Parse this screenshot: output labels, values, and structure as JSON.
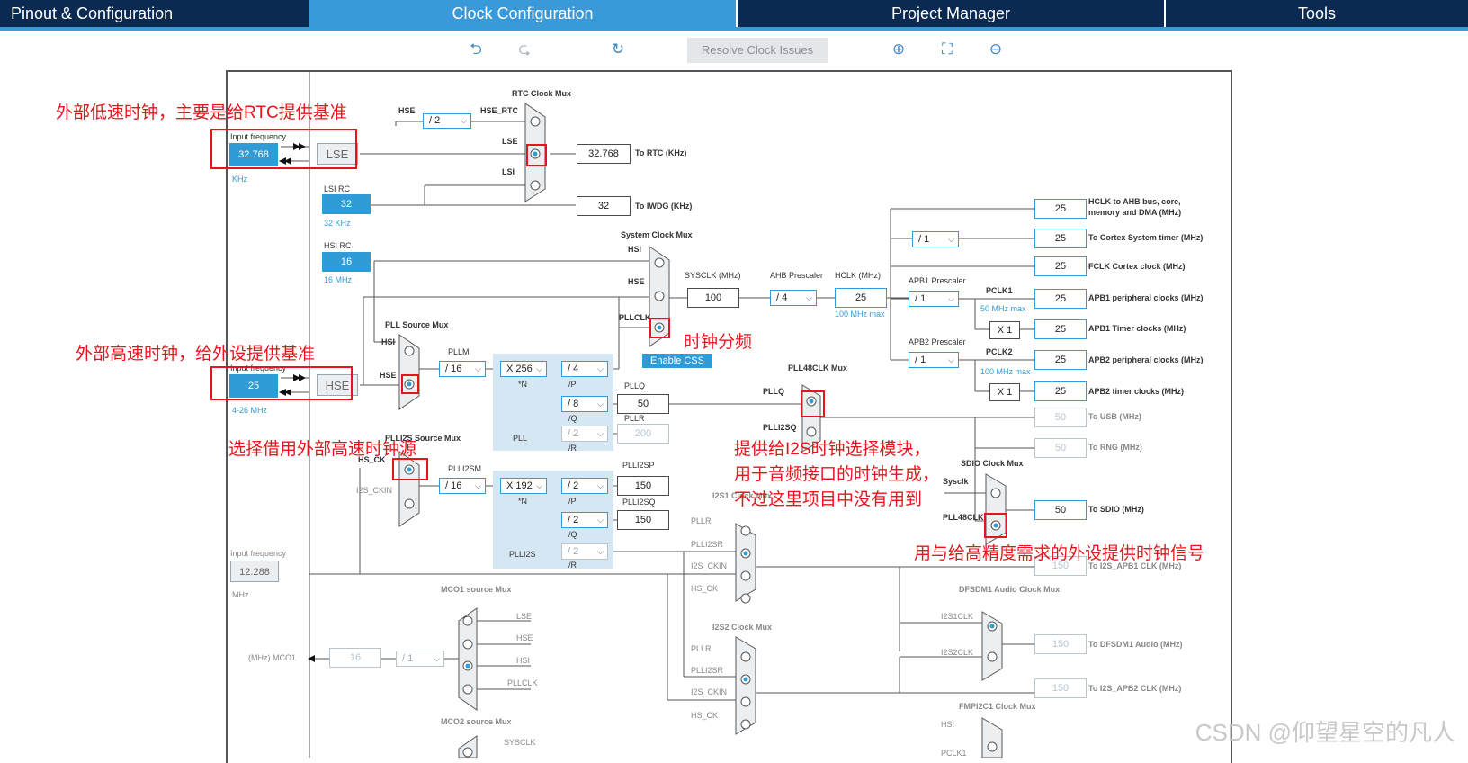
{
  "tabs": [
    "Pinout & Configuration",
    "Clock Configuration",
    "Project Manager",
    "Tools"
  ],
  "toolbar": {
    "undo": "undo-icon",
    "redo": "redo-icon",
    "refresh": "refresh-icon",
    "resolve": "Resolve Clock Issues",
    "zoom_in": "zoom-in-icon",
    "fit": "fit-icon",
    "zoom_out": "zoom-out-icon"
  },
  "lse": {
    "label_top": "Input frequency",
    "value": "32.768",
    "unit": "KHz",
    "name": "LSE"
  },
  "lsirc": {
    "label": "LSI RC",
    "value": "32",
    "unit": "32 KHz"
  },
  "hsirc": {
    "label": "HSI RC",
    "value": "16",
    "unit": "16 MHz"
  },
  "hse": {
    "label_top": "Input frequency",
    "value": "25",
    "unit": "4-26 MHz",
    "name": "HSE"
  },
  "i2s_ckin": {
    "label_top": "Input frequency",
    "value": "12.288",
    "unit": "MHz"
  },
  "rtc": {
    "title": "RTC Clock Mux",
    "hse": "HSE",
    "div": "/ 2",
    "hse_rtc": "HSE_RTC",
    "lse": "LSE",
    "lsi": "LSI",
    "out_val": "32.768",
    "out_lbl": "To RTC (KHz)"
  },
  "iwdg": {
    "out_val": "32",
    "out_lbl": "To IWDG (KHz)"
  },
  "sysmux": {
    "title": "System Clock Mux",
    "hsi": "HSI",
    "hse": "HSE",
    "pllclk": "PLLCLK",
    "sysclk_lbl": "SYSCLK (MHz)",
    "sysclk_val": "100",
    "enable_css": "Enable CSS"
  },
  "ahb": {
    "label": "AHB Prescaler",
    "div": "/ 4",
    "hclk_lbl": "HCLK (MHz)",
    "hclk_val": "25",
    "hclk_max": "100 MHz max"
  },
  "apb1": {
    "label": "APB1 Prescaler",
    "div": "/ 1",
    "pclk_lbl": "PCLK1",
    "max": "50 MHz max",
    "x": "X 1"
  },
  "apb2": {
    "label": "APB2 Prescaler",
    "div": "/ 1",
    "pclk_lbl": "PCLK2",
    "max": "100 MHz max",
    "x": "X 1"
  },
  "cortex_div": "/ 1",
  "outputs": [
    {
      "val": "25",
      "lbl": "HCLK to AHB bus, core,",
      "lbl2": "memory and DMA (MHz)"
    },
    {
      "val": "25",
      "lbl": "To Cortex System timer (MHz)"
    },
    {
      "val": "25",
      "lbl": "FCLK Cortex clock (MHz)"
    },
    {
      "val": "25",
      "lbl": "APB1 peripheral clocks (MHz)"
    },
    {
      "val": "25",
      "lbl": "APB1 Timer clocks (MHz)"
    },
    {
      "val": "25",
      "lbl": "APB2 peripheral clocks (MHz)"
    },
    {
      "val": "25",
      "lbl": "APB2 timer clocks (MHz)"
    },
    {
      "val": "50",
      "lbl": "To USB (MHz)"
    },
    {
      "val": "50",
      "lbl": "To RNG (MHz)"
    },
    {
      "val": "50",
      "lbl": "To SDIO (MHz)"
    },
    {
      "val": "150",
      "lbl": "To I2S_APB1 CLK (MHz)"
    },
    {
      "val": "150",
      "lbl": "To DFSDM1 Audio (MHz)"
    },
    {
      "val": "150",
      "lbl": "To I2S_APB2 CLK (MHz)"
    }
  ],
  "pllsrc": {
    "title": "PLL Source Mux",
    "hsi": "HSI",
    "hse": "HSE",
    "pllm_lbl": "PLLM",
    "pllm": "/ 16"
  },
  "pll": {
    "n": "X 256",
    "n_lbl": "*N",
    "p": "/ 4",
    "p_lbl": "/P",
    "q": "/ 8",
    "q_lbl": "/Q",
    "r": "/ 2",
    "r_lbl": "/R",
    "name": "PLL",
    "pllq_lbl": "PLLQ",
    "pllq": "50",
    "pllr_lbl": "PLLR",
    "pllr": "200"
  },
  "plli2ssrc": {
    "title": "PLLI2S Source Mux",
    "hs_ck": "HS_CK",
    "i2s_ckin": "I2S_CKIN",
    "m_lbl": "PLLI2SM",
    "m": "/ 16"
  },
  "plli2s": {
    "n": "X 192",
    "n_lbl": "*N",
    "p": "/ 2",
    "p_lbl": "/P",
    "q": "/ 2",
    "q_lbl": "/Q",
    "r": "/ 2",
    "r_lbl": "/R",
    "name": "PLLI2S",
    "p_out_lbl": "PLLI2SP",
    "p_out": "150",
    "q_out_lbl": "PLLI2SQ",
    "q_out": "150"
  },
  "pll48": {
    "title": "PLL48CLK Mux",
    "pllq": "PLLQ",
    "plli2sq": "PLLI2SQ"
  },
  "sdio": {
    "title": "SDIO Clock Mux",
    "sysclk": "Sysclk",
    "pll48": "PLL48CLK"
  },
  "i2s1": {
    "title": "I2S1 Clock Mux",
    "pllr": "PLLR",
    "plli2sr": "PLLI2SR",
    "i2s_ckin": "I2S_CKIN",
    "hs_ck": "HS_CK"
  },
  "i2s2": {
    "title": "I2S2 Clock Mux",
    "pllr": "PLLR",
    "plli2sr": "PLLI2SR",
    "i2s_ckin": "I2S_CKIN",
    "hs_ck": "HS_CK"
  },
  "dfsdm": {
    "title": "DFSDM1 Audio Clock Mux",
    "i2s1": "I2S1CLK",
    "i2s2": "I2S2CLK"
  },
  "fmpi2c": {
    "title": "FMPI2C1 Clock Mux",
    "hsi": "HSI",
    "pclk1": "PCLK1"
  },
  "mco1": {
    "title": "MCO1 source Mux",
    "lse": "LSE",
    "hse": "HSE",
    "hsi": "HSI",
    "pllclk": "PLLCLK",
    "out_lbl": "(MHz) MCO1",
    "val": "16",
    "div": "/ 1"
  },
  "mco2": {
    "title": "MCO2 source Mux",
    "sysclk": "SYSCLK"
  },
  "annotations": {
    "a1": "外部低速时钟，主要是给RTC提供基准",
    "a2": "外部高速时钟，给外设提供基准",
    "a3": "选择借用外部高速时钟源",
    "a4": "时钟分频",
    "a5": "提供给I2S时钟选择模块，",
    "a6": "用于音频接口的时钟生成，",
    "a7": "不过这里项目中没有用到",
    "a8": "用与给高精度需求的外设提供时钟信号"
  },
  "watermark": "CSDN @仰望星空的凡人",
  "colors": {
    "tabbar": "#0a2a52",
    "accent": "#3a9ad9",
    "annotation": "#e8141c"
  }
}
